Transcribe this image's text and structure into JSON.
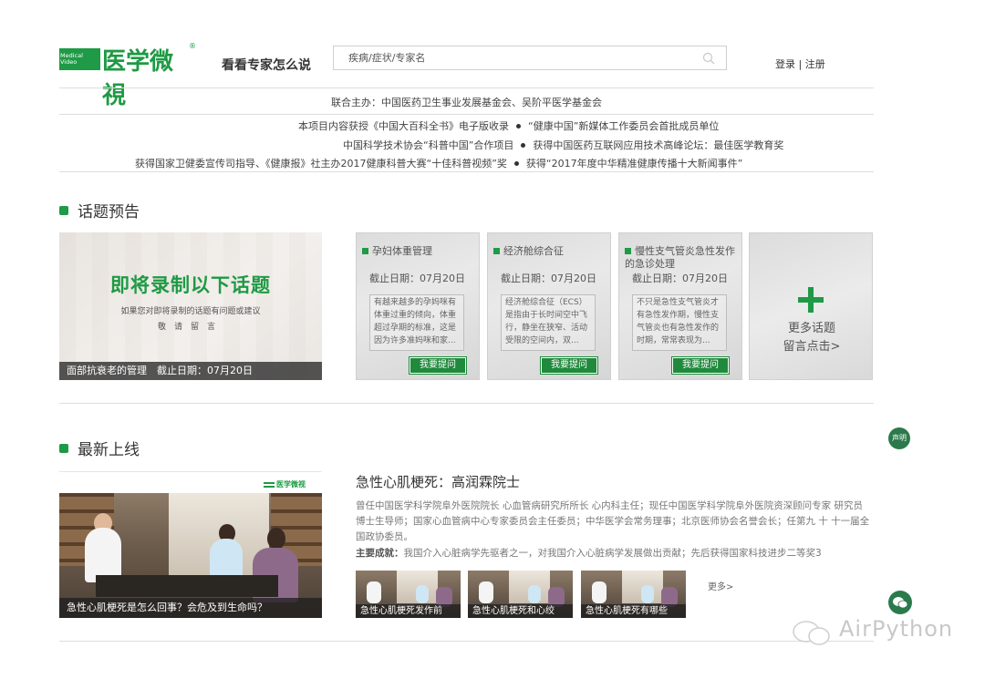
{
  "header": {
    "logo_en": "Medical Video",
    "logo_cn": "医学微視",
    "logo_reg": "®",
    "tagline": "看看专家怎么说",
    "search_placeholder": "疾病/症状/专家名",
    "login": "登录",
    "separator": " | ",
    "register": "注册"
  },
  "info": {
    "sponsor": "联合主办：中国医药卫生事业发展基金会、吴阶平医学基金会",
    "awards": [
      {
        "left": "本项目内容获授《中国大百科全书》电子版收录",
        "right": "“健康中国”新媒体工作委员会首批成员单位"
      },
      {
        "left": "中国科学技术协会“科普中国”合作项目",
        "right": "获得中国医药互联网应用技术高峰论坛：最佳医学教育奖"
      },
      {
        "left": "获得国家卫健委宣传司指导、《健康报》社主办2017健康科普大赛“十佳科普视频”奖",
        "right": "获得“2017年度中华精准健康传播十大新闻事件”"
      }
    ]
  },
  "preview": {
    "section_title": "话题预告",
    "main": {
      "headline": "即将录制以下话题",
      "sub1": "如果您对即将录制的话题有问题或建议",
      "sub2": "敬请留言",
      "caption": "面部抗衰老的管理　截止日期：07月20日"
    },
    "topics": [
      {
        "title": "孕妇体重管理",
        "date": "截止日期：07月20日",
        "desc": "有越来越多的孕妈咪有体重过重的倾向，体重超过孕期的标准，这是因为许多准妈咪和家...",
        "button": "我要提问"
      },
      {
        "title": "经济舱综合征",
        "date": "截止日期：07月20日",
        "desc": "经济舱综合征（ECS）是指由于长时间空中飞行，静坐在狭窄、活动受限的空间内，双...",
        "button": "我要提问"
      },
      {
        "title": "慢性支气管炎急性发作的急诊处理",
        "date": "截止日期：07月20日",
        "desc": "不只是急性支气管炎才有急性发作期，慢性支气管炎也有急性发作的时期，常常表现为...",
        "button": "我要提问"
      }
    ],
    "more": {
      "line1": "更多话题",
      "line2": "留言点击>"
    }
  },
  "latest": {
    "section_title": "最新上线",
    "video_logo": "医学微视",
    "video_caption": "急性心肌梗死是怎么回事？会危及到生命吗？",
    "expert_name": "急性心肌梗死：高润霖院士",
    "bio": "曾任中国医学科学院阜外医院院长 心血管病研究所所长 心内科主任；现任中国医学科学院阜外医院资深顾问专家 研究员 博士生导师；国家心血管病中心专家委员会主任委员；中华医学会常务理事；北京医师协会名誉会长；任第九 十 十一届全国政协委员。",
    "achievement_label": "主要成就：",
    "achievement": "我国介入心脏病学先驱者之一，对我国介入心脏病学发展做出贡献；先后获得国家科技进步二等奖3",
    "thumbs": [
      "急性心肌梗死发作前",
      "急性心肌梗死和心绞",
      "急性心肌梗死有哪些"
    ],
    "more": "更多>"
  },
  "floating": {
    "statement": "声明",
    "watermark": "AirPython"
  },
  "colors": {
    "brand_green": "#1f9a46",
    "button_green": "#1f8a3c"
  }
}
